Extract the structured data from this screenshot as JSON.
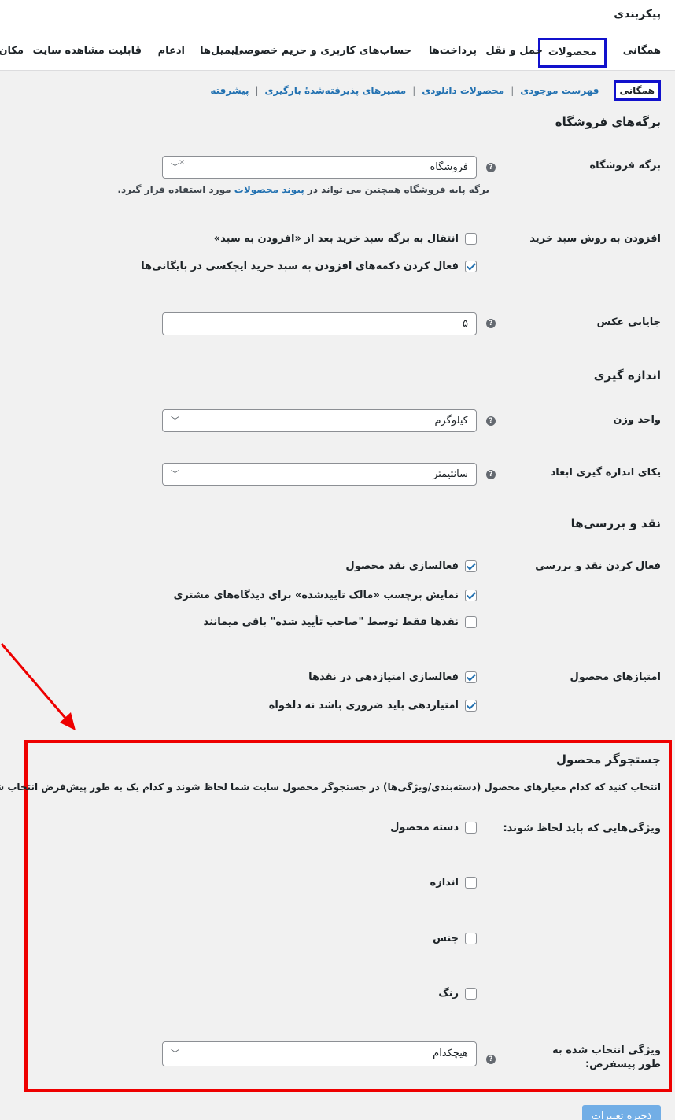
{
  "header": {
    "title": "پیکربندی"
  },
  "tabs": [
    {
      "label": "همگانی"
    },
    {
      "label": "محصولات"
    },
    {
      "label": "حمل و نقل"
    },
    {
      "label": "پرداخت‌ها"
    },
    {
      "label": "حساب‌های کاربری و حریم خصوصی"
    },
    {
      "label": "ایمیل‌ها"
    },
    {
      "label": "ادغام"
    },
    {
      "label": "قابلیت مشاهده سایت"
    },
    {
      "label": "مکان"
    }
  ],
  "subnav": {
    "current": "همگانی",
    "links": [
      "فهرست موجودی",
      "محصولات دانلودی",
      "مسیرهای پذیرفته‌شدهٔ بارگیری",
      "پیشرفته"
    ],
    "separator": "|"
  },
  "shop_pages": {
    "heading": "برگه‌های فروشگاه",
    "shop_page_label": "برگه فروشگاه",
    "shop_page_value": "فروشگاه",
    "shop_page_desc_before": "برگه پایه فروشگاه همچنین می تواند در",
    "shop_page_desc_link": "پیوند محصولات",
    "shop_page_desc_after": "مورد استفاده قرار گیرد.",
    "add_to_cart_label": "افزودن به روش سبد خرید",
    "redirect_cart_label": "انتقال به برگه سبد خرید بعد از «افزودن به سبد»",
    "redirect_cart_checked": false,
    "ajax_cart_label": "فعال کردن دکمه‌های افزودن به سبد خرید ایجکسی در بایگانی‌ها",
    "ajax_cart_checked": true,
    "placeholder_label": "جایابی عکس",
    "placeholder_value": "۵"
  },
  "measurements": {
    "heading": "اندازه گیری",
    "weight_label": "واحد وزن",
    "weight_value": "کیلوگرم",
    "dimension_label": "یکای اندازه گیری ابعاد",
    "dimension_value": "سانتیمتر"
  },
  "reviews": {
    "heading": "نقد و بررسی‌ها",
    "enable_label": "فعال کردن نقد و بررسی",
    "enable_reviews": "فعالسازی نقد محصول",
    "enable_reviews_checked": true,
    "verified_label": "نمایش برچسب «مالک تاییدشده» برای دیدگاه‌های مشتری",
    "verified_checked": true,
    "verified_only": "نقدها فقط توسط \"صاحب تأیید شده\" باقی میمانند",
    "verified_only_checked": false,
    "ratings_label": "امتیازهای محصول",
    "enable_ratings": "فعالسازی امتیازدهی در نقدها",
    "enable_ratings_checked": true,
    "ratings_required": "امتیازدهی باید ضروری باشد نه دلخواه",
    "ratings_required_checked": true
  },
  "product_search": {
    "heading": "جستجوگر محصول",
    "description": "انتخاب کنید که کدام معیارهای محصول (دسته‌بندی/ویژگی‌ها) در جستجوگر محصول سایت شما لحاظ شوند و کدام یک به طور پیش‌فرض انتخاب شوند.",
    "attributes_label": "ویژگی‌هایی که باید لحاظ شوند:",
    "attributes": [
      {
        "label": "دسته محصول",
        "checked": false
      },
      {
        "label": "اندازه",
        "checked": false
      },
      {
        "label": "جنس",
        "checked": false
      },
      {
        "label": "رنگ",
        "checked": false
      }
    ],
    "default_label": "ویژگی انتخاب شده به طور پیشفرض:",
    "default_value": "هیچکدام"
  },
  "actions": {
    "save_label": "ذخیره تغییرات"
  },
  "colors": {
    "accent": "#2271b1",
    "highlight_box": "#1111cc",
    "annotation_red": "#ee0000"
  },
  "icons": {
    "help": "?",
    "chevron": "﹀",
    "clear": "×"
  }
}
